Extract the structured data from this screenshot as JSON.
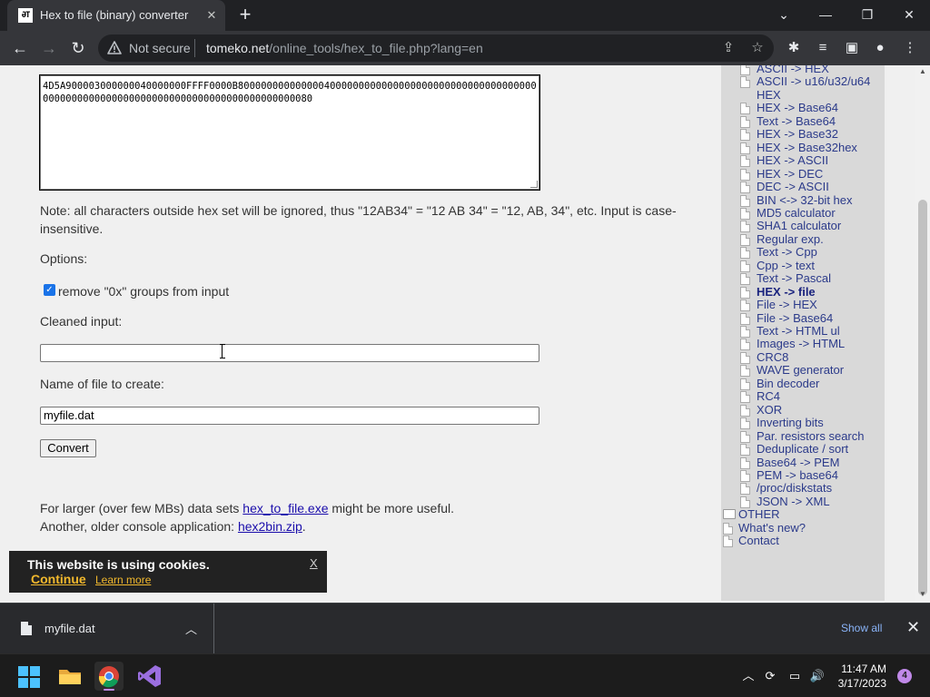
{
  "browser": {
    "tab_title": "Hex to file (binary) converter",
    "favicon_text": "ƏT",
    "security_label": "Not secure",
    "url_domain": "tomeko.net",
    "url_path": "/online_tools/hex_to_file.php?lang=en"
  },
  "main": {
    "hex_text": "4D5A900003000000040000000FFFF0000B800000000000000400000000000000000000000000000000000000000000000000000000000000000000000000000000080",
    "note": "Note: all characters outside hex set will be ignored, thus \"12AB34\" = \"12 AB 34\" = \"12, AB, 34\", etc. Input is case-insensitive.",
    "options_label": "Options:",
    "remove_0x_label": "remove \"0x\" groups from input",
    "remove_0x_checked": true,
    "cleaned_label": "Cleaned input:",
    "cleaned_value": "",
    "filename_label": "Name of file to create:",
    "filename_value": "myfile.dat",
    "convert_label": "Convert",
    "larger_prefix": "For larger (over few MBs) data sets ",
    "larger_link": "hex_to_file.exe",
    "larger_suffix": " might be more useful.",
    "older_prefix": "Another, older console application: ",
    "older_link": "hex2bin.zip",
    "older_suffix": "."
  },
  "sidebar": {
    "items": [
      {
        "label": "ASCII -> HEX",
        "icon": "doc"
      },
      {
        "label": "ASCII -> u16/u32/u64",
        "icon": "doc"
      },
      {
        "label": "HEX",
        "icon": "none"
      },
      {
        "label": "HEX -> Base64",
        "icon": "doc"
      },
      {
        "label": "Text -> Base64",
        "icon": "doc"
      },
      {
        "label": "HEX -> Base32",
        "icon": "doc"
      },
      {
        "label": "HEX -> Base32hex",
        "icon": "doc"
      },
      {
        "label": "HEX -> ASCII",
        "icon": "doc"
      },
      {
        "label": "HEX -> DEC",
        "icon": "doc"
      },
      {
        "label": "DEC -> ASCII",
        "icon": "doc"
      },
      {
        "label": "BIN <-> 32-bit hex",
        "icon": "doc"
      },
      {
        "label": "MD5 calculator",
        "icon": "doc"
      },
      {
        "label": "SHA1 calculator",
        "icon": "doc"
      },
      {
        "label": "Regular exp.",
        "icon": "doc"
      },
      {
        "label": "Text -> Cpp",
        "icon": "doc"
      },
      {
        "label": "Cpp -> text",
        "icon": "doc"
      },
      {
        "label": "Text -> Pascal",
        "icon": "doc"
      },
      {
        "label": "HEX -> file",
        "icon": "doc",
        "active": true
      },
      {
        "label": "File -> HEX",
        "icon": "doc"
      },
      {
        "label": "File -> Base64",
        "icon": "doc"
      },
      {
        "label": "Text -> HTML ul",
        "icon": "doc"
      },
      {
        "label": "Images -> HTML",
        "icon": "doc"
      },
      {
        "label": "CRC8",
        "icon": "doc"
      },
      {
        "label": "WAVE generator",
        "icon": "doc"
      },
      {
        "label": "Bin decoder",
        "icon": "doc"
      },
      {
        "label": "RC4",
        "icon": "doc"
      },
      {
        "label": "XOR",
        "icon": "doc"
      },
      {
        "label": "Inverting bits",
        "icon": "doc"
      },
      {
        "label": "Par. resistors search",
        "icon": "doc"
      },
      {
        "label": "Deduplicate / sort",
        "icon": "doc"
      },
      {
        "label": "Base64 -> PEM",
        "icon": "doc"
      },
      {
        "label": "PEM -> base64",
        "icon": "doc"
      },
      {
        "label": "/proc/diskstats",
        "icon": "doc"
      },
      {
        "label": "JSON -> XML",
        "icon": "doc"
      },
      {
        "label": "OTHER",
        "icon": "folder",
        "level": 0
      },
      {
        "label": "What's new?",
        "icon": "doc",
        "level": 0
      },
      {
        "label": "Contact",
        "icon": "doc",
        "level": 0
      }
    ]
  },
  "cookie": {
    "message": "This website is using cookies.",
    "continue_label": "Continue",
    "learn_more_label": "Learn more",
    "close_label": "X"
  },
  "downloads": {
    "file_name": "myfile.dat",
    "show_all_label": "Show all"
  },
  "taskbar": {
    "time": "11:47 AM",
    "date": "3/17/2023",
    "notification_count": "4"
  }
}
